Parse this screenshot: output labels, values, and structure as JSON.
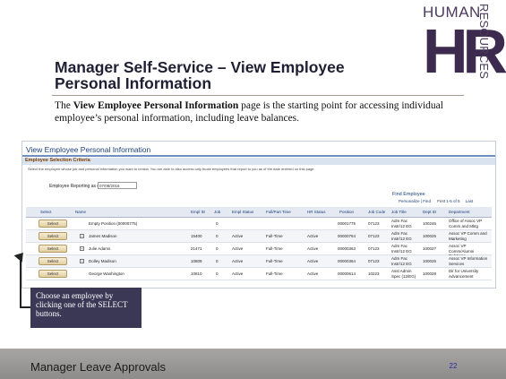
{
  "logo": {
    "top": "HUMAN",
    "letters": "HR",
    "side": "RESOURCES"
  },
  "slide": {
    "title": "Manager Self-Service – View Employee Personal Information",
    "intro_pre": "The ",
    "intro_bold": "View Employee Personal Information",
    "intro_post": " page is the starting point for accessing individual employee’s personal information, including leave balances."
  },
  "screenshot": {
    "page_title": "View Employee Personal Information",
    "section": "Employee Selection Criteria",
    "instructions": "Select the employee whose job and personal information you want to review. You are able to also access only those employees that report to you as of the date entered on this page.",
    "reporting_label": "Employee Reporting as of",
    "reporting_date": "07/08/2016",
    "find_employee": "Find Employee",
    "grid_nav": {
      "personalize": "Personalize",
      "find": "Find",
      "first": "First",
      "range": "1-5 of 5",
      "last": "Last"
    },
    "columns": [
      "Select",
      "Name",
      "Empl ID",
      "Job",
      "Empl Status",
      "Full/Part Time",
      "HR Status",
      "Position",
      "Job Code",
      "Job Title",
      "Dept ID",
      "Department"
    ],
    "rows": [
      {
        "select": "Select",
        "name": "Empty Position (00000775)",
        "empl_id": "",
        "job": "0",
        "status": "",
        "ft": "",
        "hr": "",
        "position": "00001775",
        "jobcode": "07123",
        "title": "Adm Fac Instr/12 EG",
        "dept": "100246",
        "deptname": "Office of Assoc VP Comm and Mktg"
      },
      {
        "select": "Select",
        "name": "James Madison",
        "empl_id": "15400",
        "job": "0",
        "status": "Active",
        "ft": "Full-Time",
        "hr": "Active",
        "position": "00000764",
        "jobcode": "07123",
        "title": "Adm Fac Instr/12 EG",
        "dept": "100025",
        "deptname": "Assoc VP Comm and Marketing"
      },
      {
        "select": "Select",
        "name": "Julie Adams",
        "empl_id": "21471",
        "job": "0",
        "status": "Active",
        "ft": "Full-Time",
        "hr": "Active",
        "position": "00000363",
        "jobcode": "07123",
        "title": "Adm Fac Instr/12 EG",
        "dept": "100027",
        "deptname": "Assoc VP Comm/Alumni Relations"
      },
      {
        "select": "Select",
        "name": "Dolley Madison",
        "empl_id": "10809",
        "job": "0",
        "status": "Active",
        "ft": "Full-Time",
        "hr": "Active",
        "position": "00000364",
        "jobcode": "07123",
        "title": "Adm Fac Instr/12 EG",
        "dept": "100025",
        "deptname": "Assoc VP Information Services"
      },
      {
        "select": "Select",
        "name": "George Washington",
        "empl_id": "10810",
        "job": "0",
        "status": "Active",
        "ft": "Full-Time",
        "hr": "Active",
        "position": "00000614",
        "jobcode": "10223",
        "title": "Asst Admin Spec (12/EG)",
        "dept": "100028",
        "deptname": "Dir for University Advancement"
      }
    ]
  },
  "callout": {
    "text": "Choose an employee by clicking one of the SELECT buttons."
  },
  "footer": {
    "title": "Manager Leave Approvals",
    "page": "22"
  },
  "colors": {
    "title": "#1f1f33",
    "callout_bg": "#3b3856",
    "footer": "#9a9997",
    "link": "#1a3f7a",
    "page_number": "#2a2aa0"
  }
}
